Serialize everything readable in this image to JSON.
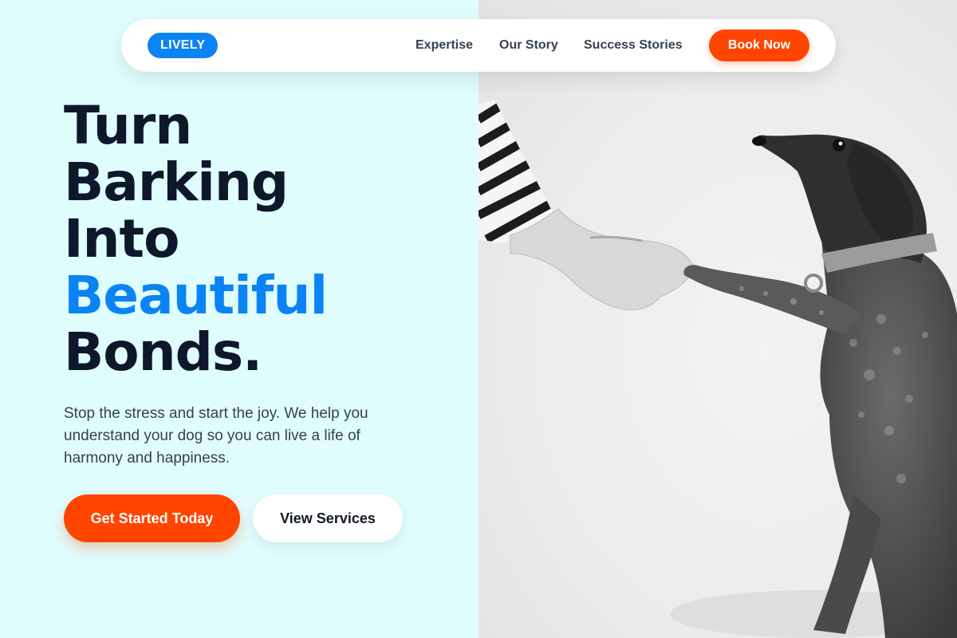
{
  "nav": {
    "logo": "LIVELY",
    "links": [
      "Expertise",
      "Our Story",
      "Success Stories"
    ],
    "cta": "Book Now"
  },
  "hero": {
    "title_lines": [
      "Turn",
      "Barking",
      "Into"
    ],
    "title_accent": "Beautiful",
    "title_end": "Bonds.",
    "subtitle": "Stop the stress and start the joy. We help you understand your dog so you can live a life of harmony and happiness.",
    "primary_cta": "Get Started Today",
    "secondary_cta": "View Services"
  },
  "photo": {
    "icon": "dog-paw-handshake-photo"
  },
  "colors": {
    "accent_blue": "#0b84f3",
    "accent_orange": "#ff4500",
    "hero_background": "#e0fdfd",
    "title_text": "#0f172a"
  }
}
